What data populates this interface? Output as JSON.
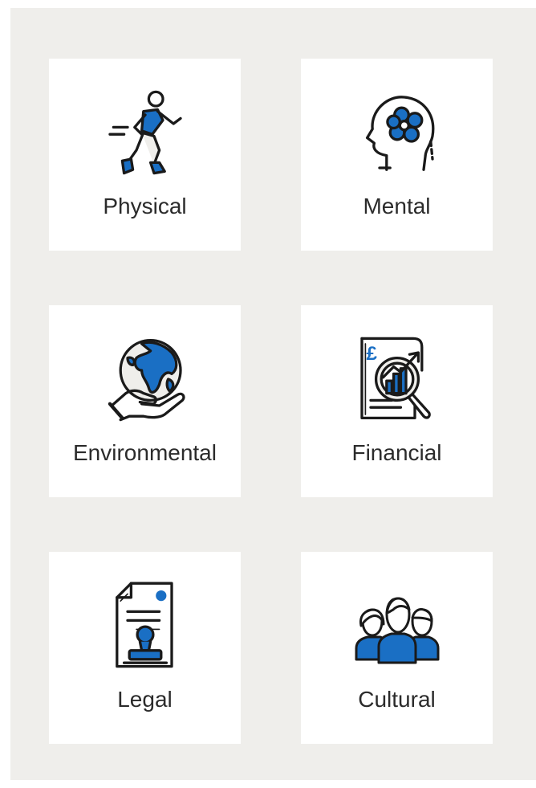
{
  "colors": {
    "accent": "#1a6fc4",
    "outline": "#1a1a1a",
    "panel": "#efeeeb",
    "card": "#ffffff"
  },
  "cards": [
    {
      "label": "Physical",
      "icon": "runner-icon"
    },
    {
      "label": "Mental",
      "icon": "head-flower-icon"
    },
    {
      "label": "Environmental",
      "icon": "globe-in-hand-icon"
    },
    {
      "label": "Financial",
      "icon": "financial-report-icon"
    },
    {
      "label": "Legal",
      "icon": "document-stamp-icon"
    },
    {
      "label": "Cultural",
      "icon": "group-people-icon"
    }
  ]
}
